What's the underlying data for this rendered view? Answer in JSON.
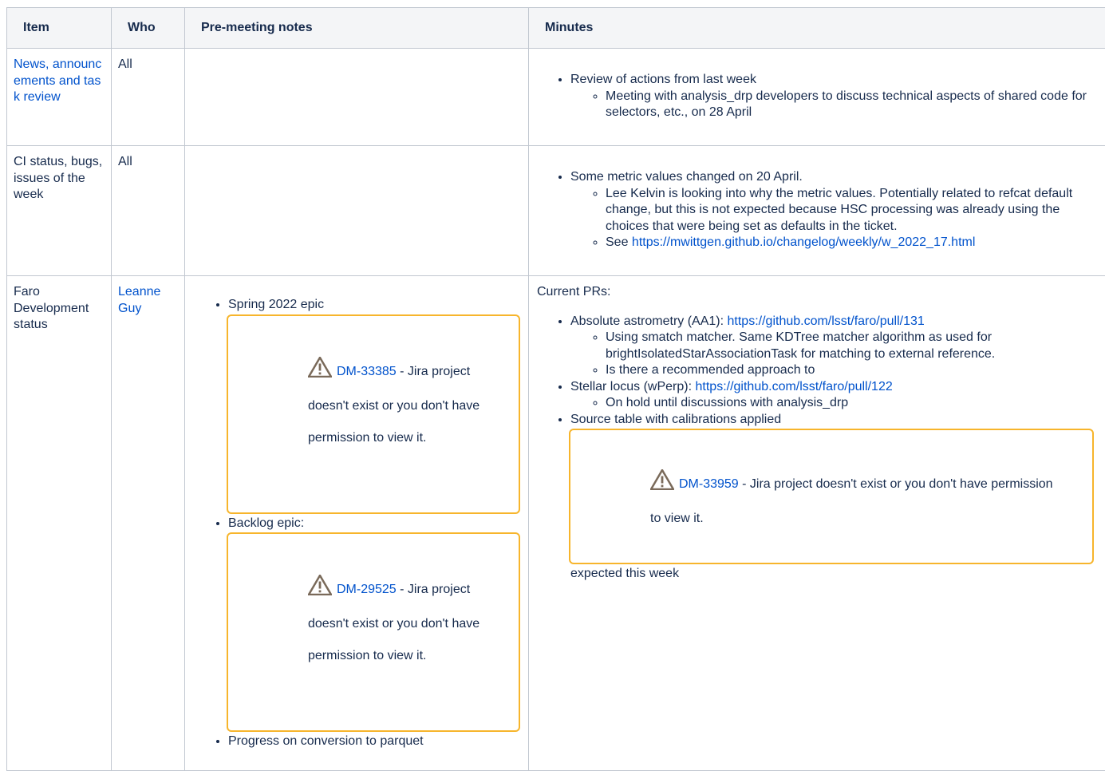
{
  "table": {
    "headers": {
      "item": "Item",
      "who": "Who",
      "notes": "Pre-meeting notes",
      "minutes": "Minutes"
    },
    "rows": [
      {
        "item": "News, announcements and task review",
        "who": "All",
        "minutes": {
          "b1": "Review of actions from last week",
          "b1_s1": "Meeting with analysis_drp developers to discuss technical aspects of shared code for selectors, etc., on 28 April"
        }
      },
      {
        "item": "CI status, bugs, issues of the week",
        "who": "All",
        "minutes": {
          "b1": "Some metric values changed on 20 April.",
          "b1_s1": "Lee Kelvin is looking into why the metric values. Potentially related to refcat default change, but this is not expected because HSC processing was already using the choices that were being set as defaults in the ticket.",
          "b1_s2_prefix": "See ",
          "b1_s2_link": "https://mwittgen.github.io/changelog/weekly/w_2022_17.html"
        }
      },
      {
        "item": "Faro Development status",
        "who": "Leanne Guy",
        "notes": {
          "b1": "Spring 2022 epic",
          "jira1_key": "DM-33385",
          "jira1_msg": " - Jira project doesn't exist or you don't have permission to view it.",
          "b2": "Backlog epic:",
          "jira2_key": "DM-29525",
          "jira2_msg": " - Jira project doesn't exist or you don't have permission to view it.",
          "b3": "Progress on conversion to parquet"
        },
        "minutes": {
          "intro": "Current PRs:",
          "b1_prefix": "Absolute astrometry (AA1): ",
          "b1_link": "https://github.com/lsst/faro/pull/131",
          "b1_s1": "Using smatch matcher. Same KDTree matcher algorithm as used for brightIsolatedStarAssociationTask for matching to external reference.",
          "b1_s2": "Is there a recommended approach to",
          "b2_prefix": "Stellar locus (wPerp): ",
          "b2_link": "https://github.com/lsst/faro/pull/122",
          "b2_s1": "On hold until discussions with analysis_drp",
          "b3": "Source table with calibrations applied",
          "jira_key": "DM-33959",
          "jira_msg": " - Jira project doesn't exist or you don't have permission to view it.",
          "after": "expected this week"
        }
      }
    ]
  },
  "icons": {
    "warning": "warning-icon"
  },
  "colors": {
    "link": "#0052cc",
    "jira_border": "#f7b52c",
    "header_bg": "#f4f5f7",
    "border": "#c1c7d0"
  }
}
